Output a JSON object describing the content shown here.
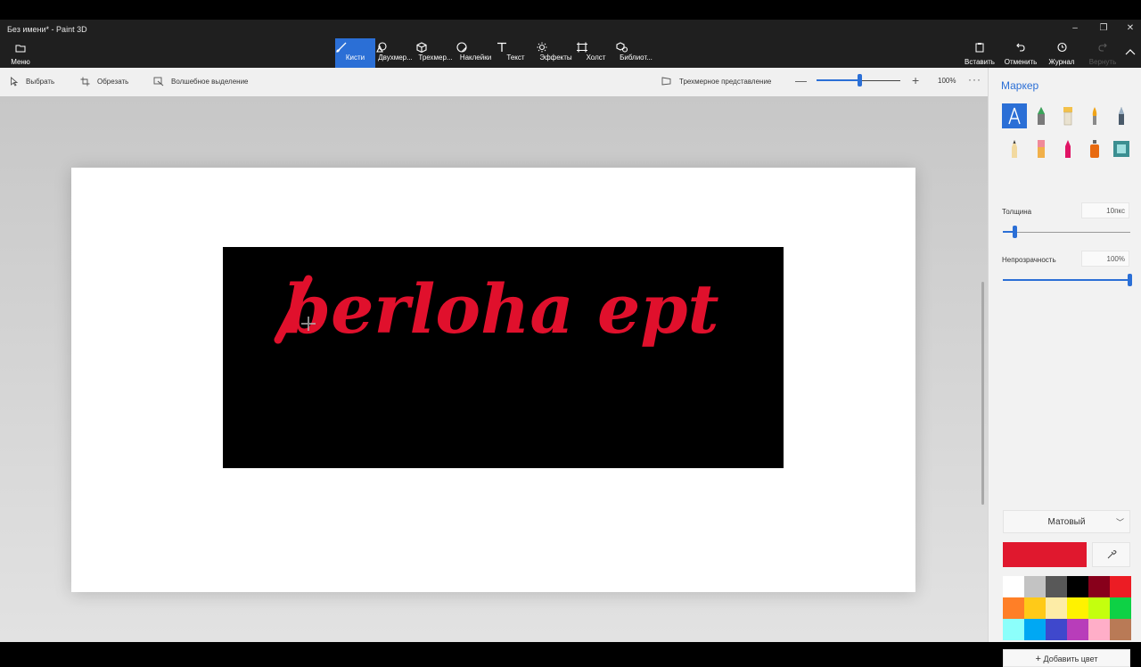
{
  "window": {
    "title": "Без имени* - Paint 3D",
    "controls": [
      "–",
      "❐",
      "✕"
    ]
  },
  "toolbar": {
    "menu_label": "Меню",
    "tabs": [
      {
        "label": "Кисти",
        "icon": "brush-icon",
        "active": true
      },
      {
        "label": "Двухмер...",
        "icon": "2d-shapes-icon",
        "active": false
      },
      {
        "label": "Трехмер...",
        "icon": "3d-shapes-icon",
        "active": false
      },
      {
        "label": "Наклейки",
        "icon": "stickers-icon",
        "active": false
      },
      {
        "label": "Текст",
        "icon": "text-icon",
        "active": false
      },
      {
        "label": "Эффекты",
        "icon": "effects-icon",
        "active": false
      },
      {
        "label": "Холст",
        "icon": "canvas-icon",
        "active": false
      },
      {
        "label": "Библиот...",
        "icon": "library-icon",
        "active": false
      }
    ],
    "right": [
      {
        "label": "Вставить",
        "icon": "paste-icon",
        "enabled": true
      },
      {
        "label": "Отменить",
        "icon": "undo-icon",
        "enabled": true
      },
      {
        "label": "Журнал",
        "icon": "history-icon",
        "enabled": true
      },
      {
        "label": "Вернуть",
        "icon": "redo-icon",
        "enabled": false
      }
    ]
  },
  "subtoolbar": {
    "select": "Выбрать",
    "crop": "Обрезать",
    "magic_select": "Волшебное выделение",
    "view3d": "Трехмерное представление",
    "zoom": "100%",
    "zoom_level": 0.52
  },
  "canvas": {
    "drawing_text": "berloha ept",
    "ink_color": "#e0102c"
  },
  "panel": {
    "title": "Маркер",
    "brushes": [
      "marker-icon",
      "calligraphy-pen-icon",
      "oil-brush-icon",
      "watercolor-icon",
      "pixel-pen-icon",
      "pencil-icon",
      "eraser-icon",
      "crayon-icon",
      "spray-can-icon",
      "fill-icon"
    ],
    "thickness_label": "Толщина",
    "thickness_value": "10пкс",
    "thickness_level": 0.1,
    "opacity_label": "Непрозрачность",
    "opacity_value": "100%",
    "opacity_level": 1.0,
    "finish": "Матовый",
    "current_color": "#e0182e",
    "add_color": "Добавить цвет",
    "palette": [
      "#ffffff",
      "#c3c3c3",
      "#585858",
      "#000000",
      "#88001b",
      "#ec1c24",
      "#ff7f27",
      "#ffca18",
      "#fdeca6",
      "#fff200",
      "#c4ff0e",
      "#0ed145",
      "#8cfffb",
      "#00a8f3",
      "#3f48cc",
      "#b83dba",
      "#ffaec8",
      "#b97a56"
    ]
  }
}
